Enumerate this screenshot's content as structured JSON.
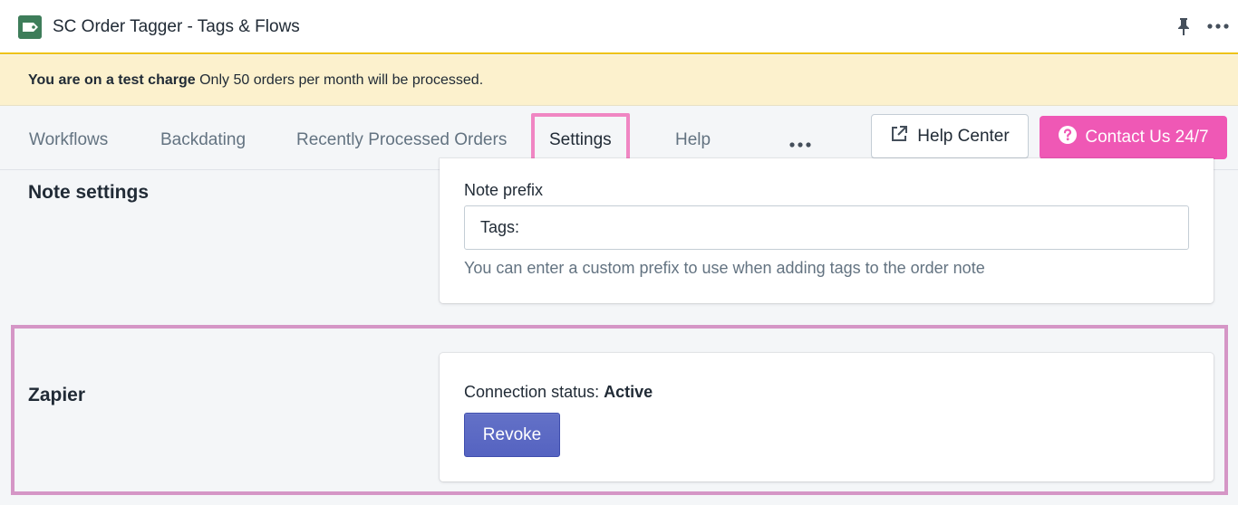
{
  "app": {
    "title": "SC Order Tagger - Tags & Flows",
    "icon": "tag-icon",
    "pin_icon": "pin-icon",
    "more_icon": "more-horizontal-icon"
  },
  "banner": {
    "bold": "You are on a test charge",
    "text": " Only 50 orders per month will be processed."
  },
  "nav": {
    "tabs": [
      {
        "label": "Workflows",
        "active": false
      },
      {
        "label": "Backdating",
        "active": false
      },
      {
        "label": "Recently Processed Orders",
        "active": false
      },
      {
        "label": "Settings",
        "active": true
      },
      {
        "label": "Help",
        "active": false
      }
    ],
    "more_icon": "more-horizontal-icon",
    "help_center_label": "Help Center",
    "help_center_icon": "external-link-icon",
    "contact_label": "Contact Us 24/7",
    "contact_icon": "question-circle-icon"
  },
  "note_settings": {
    "title": "Note settings",
    "field_label": "Note prefix",
    "field_value": "Tags:",
    "help_text": "You can enter a custom prefix to use when adding tags to the order note"
  },
  "zapier": {
    "title": "Zapier",
    "status_label": "Connection status: ",
    "status_value": "Active",
    "revoke_label": "Revoke"
  },
  "colors": {
    "banner_bg": "#fcf1cd",
    "accent_pink": "#ef58b5",
    "primary_indigo": "#5c6ac4",
    "highlight_pink": "#f086c3",
    "highlight_mauve": "#d596c6"
  }
}
